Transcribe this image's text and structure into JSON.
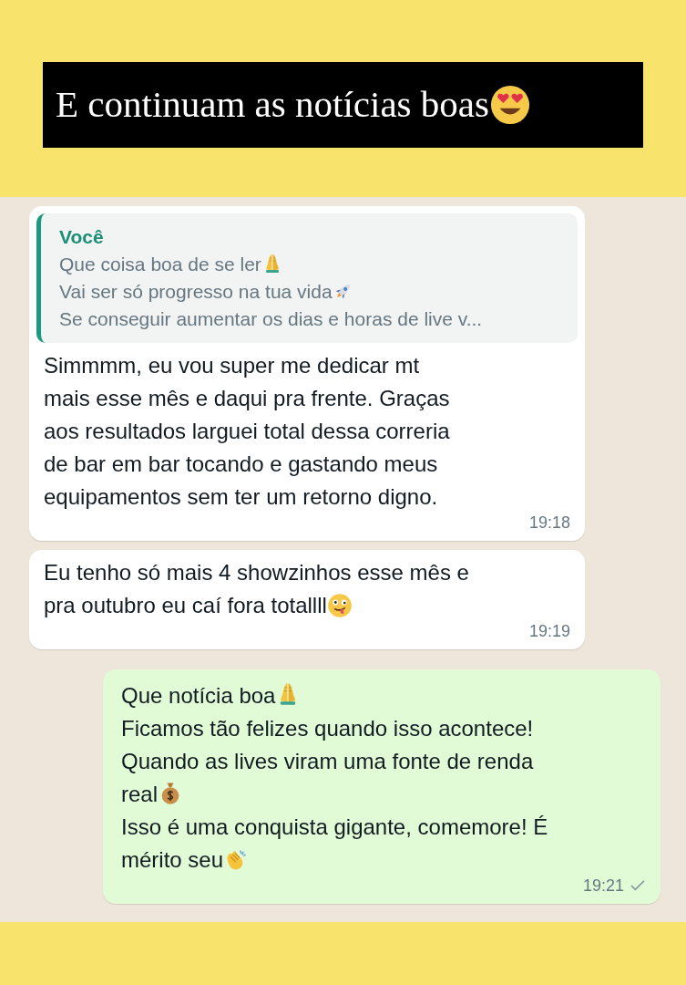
{
  "title": {
    "text": "E continuam as notícias boas",
    "kind": "hearteyes"
  },
  "messages": [
    {
      "kind": "incoming",
      "quote": {
        "author": "Você",
        "lines": [
          {
            "text": "Que coisa boa de se ler",
            "kind": "pray"
          },
          {
            "text": "Vai ser só progresso na tua vida",
            "kind": "rocket"
          },
          {
            "text": "Se conseguir aumentar os dias e horas de live v...",
            "kind": "plain"
          }
        ]
      },
      "lines": [
        {
          "text": "Simmmm, eu vou super me dedicar mt",
          "kind": "plain"
        },
        {
          "text": "mais esse mês e daqui pra frente. Graças",
          "kind": "plain"
        },
        {
          "text": "aos resultados larguei total dessa correria",
          "kind": "plain"
        },
        {
          "text": "de bar em bar tocando e gastando meus",
          "kind": "plain"
        },
        {
          "text": "equipamentos sem ter um retorno digno.",
          "kind": "plain"
        }
      ],
      "time": "19:18",
      "sent_tick": false
    },
    {
      "kind": "incoming",
      "lines": [
        {
          "text": "Eu tenho só mais 4 showzinhos esse mês e",
          "kind": "plain"
        },
        {
          "text": "pra outubro eu caí fora totallll",
          "kind": "winktongue"
        }
      ],
      "time": "19:19",
      "sent_tick": false
    },
    {
      "kind": "outgoing",
      "lines": [
        {
          "text": "Que notícia boa",
          "kind": "pray"
        },
        {
          "text": "Ficamos tão felizes quando isso acontece!",
          "kind": "plain"
        },
        {
          "text": "Quando as lives viram uma fonte de renda",
          "kind": "plain"
        },
        {
          "text": "real",
          "kind": "moneybag"
        },
        {
          "text": "Isso é uma conquista gigante, comemore! É",
          "kind": "plain"
        },
        {
          "text": "mérito seu",
          "kind": "clap"
        }
      ],
      "time": "19:21",
      "sent_tick": true
    }
  ]
}
